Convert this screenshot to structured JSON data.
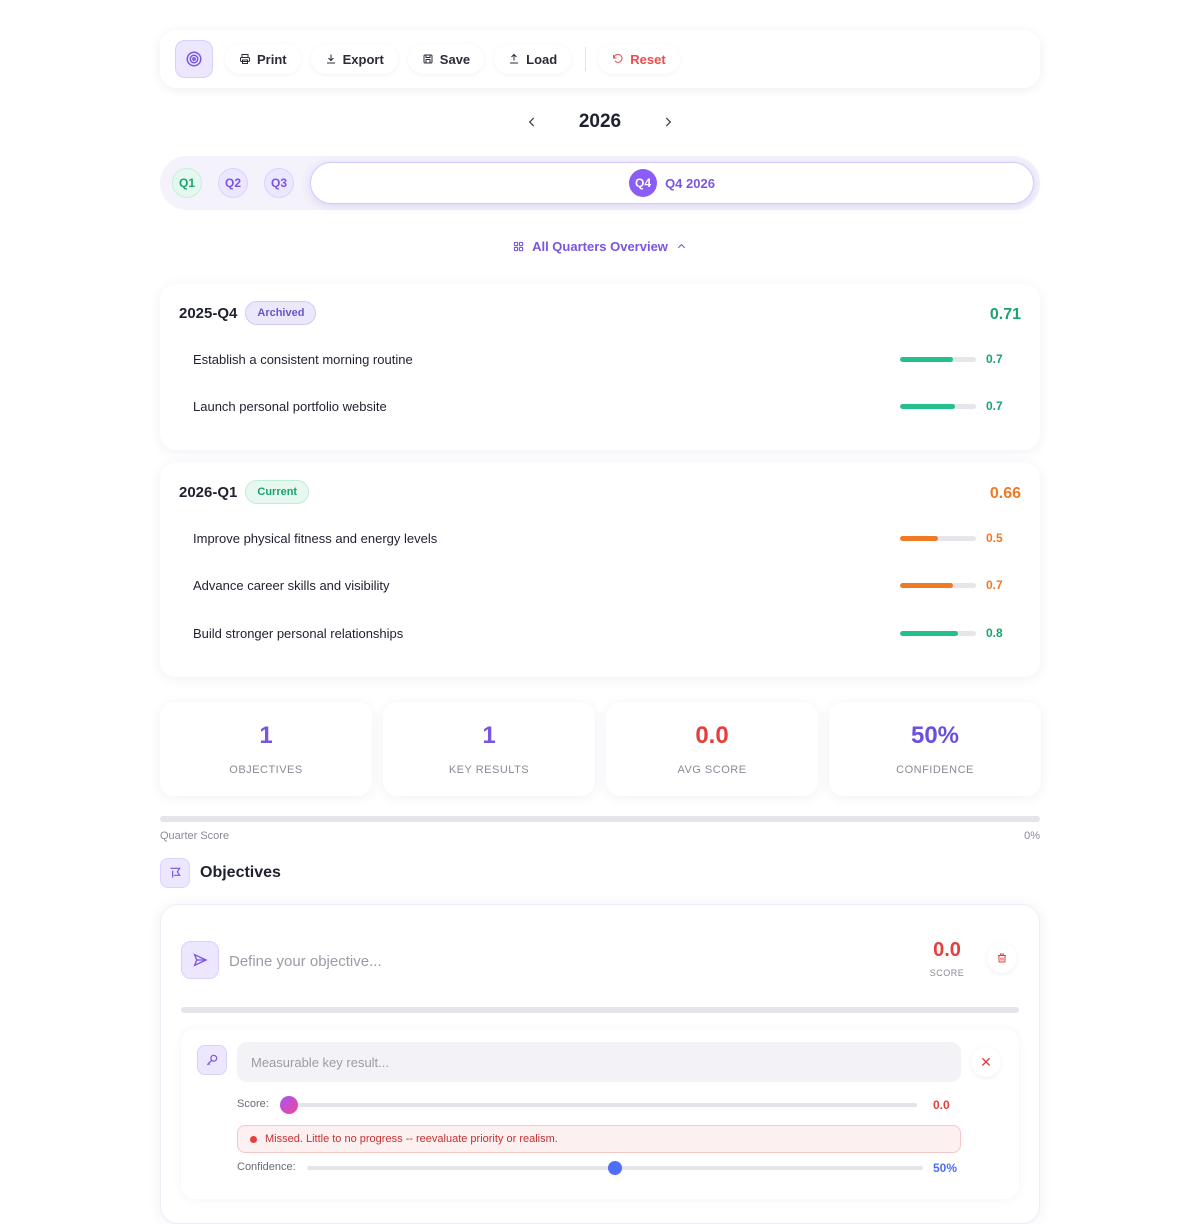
{
  "toolbar": {
    "print": "Print",
    "export": "Export",
    "save": "Save",
    "load": "Load",
    "reset": "Reset"
  },
  "year_nav": {
    "year": "2026"
  },
  "quarter_tabs": {
    "q1": "Q1",
    "q2": "Q2",
    "q3": "Q3",
    "active_badge": "Q4",
    "active_label": "Q4 2026"
  },
  "overview_toggle": {
    "label": "All Quarters Overview"
  },
  "quarters": [
    {
      "title": "2025-Q4",
      "tag": "Archived",
      "score": "0.71",
      "goals": [
        {
          "text": "Establish a consistent morning routine",
          "value": "0.7",
          "progress": 0.7
        },
        {
          "text": "Launch personal portfolio website",
          "value": "0.7",
          "progress": 0.72
        }
      ]
    },
    {
      "title": "2026-Q1",
      "tag": "Current",
      "score": "0.66",
      "goals": [
        {
          "text": "Improve physical fitness and energy levels",
          "value": "0.5",
          "progress": 0.5
        },
        {
          "text": "Advance career skills and visibility",
          "value": "0.7",
          "progress": 0.7
        },
        {
          "text": "Build stronger personal relationships",
          "value": "0.8",
          "progress": 0.76
        }
      ]
    }
  ],
  "stats": {
    "objectives": {
      "value": "1",
      "label": "OBJECTIVES"
    },
    "key_results": {
      "value": "1",
      "label": "KEY RESULTS"
    },
    "avg_score": {
      "value": "0.0",
      "label": "AVG SCORE"
    },
    "confidence": {
      "value": "50%",
      "label": "CONFIDENCE"
    }
  },
  "quarter_score": {
    "label": "Quarter Score",
    "value": "0%"
  },
  "objectives_section": {
    "title": "Objectives",
    "objective": {
      "placeholder": "Define your objective...",
      "score": "0.0",
      "score_label": "SCORE",
      "key_result": {
        "placeholder": "Measurable key result...",
        "score_label": "Score:",
        "score_value": "0.0",
        "score_level": 0.0,
        "alert": "Missed. Little to no progress -- reevaluate priority or realism.",
        "confidence_label": "Confidence:",
        "confidence_value": "50%",
        "confidence_level": 0.5
      }
    }
  },
  "colors": {
    "accent": "#7a55e0",
    "success": "#18a46c",
    "warning": "#f07a24",
    "danger": "#e53e3e"
  }
}
